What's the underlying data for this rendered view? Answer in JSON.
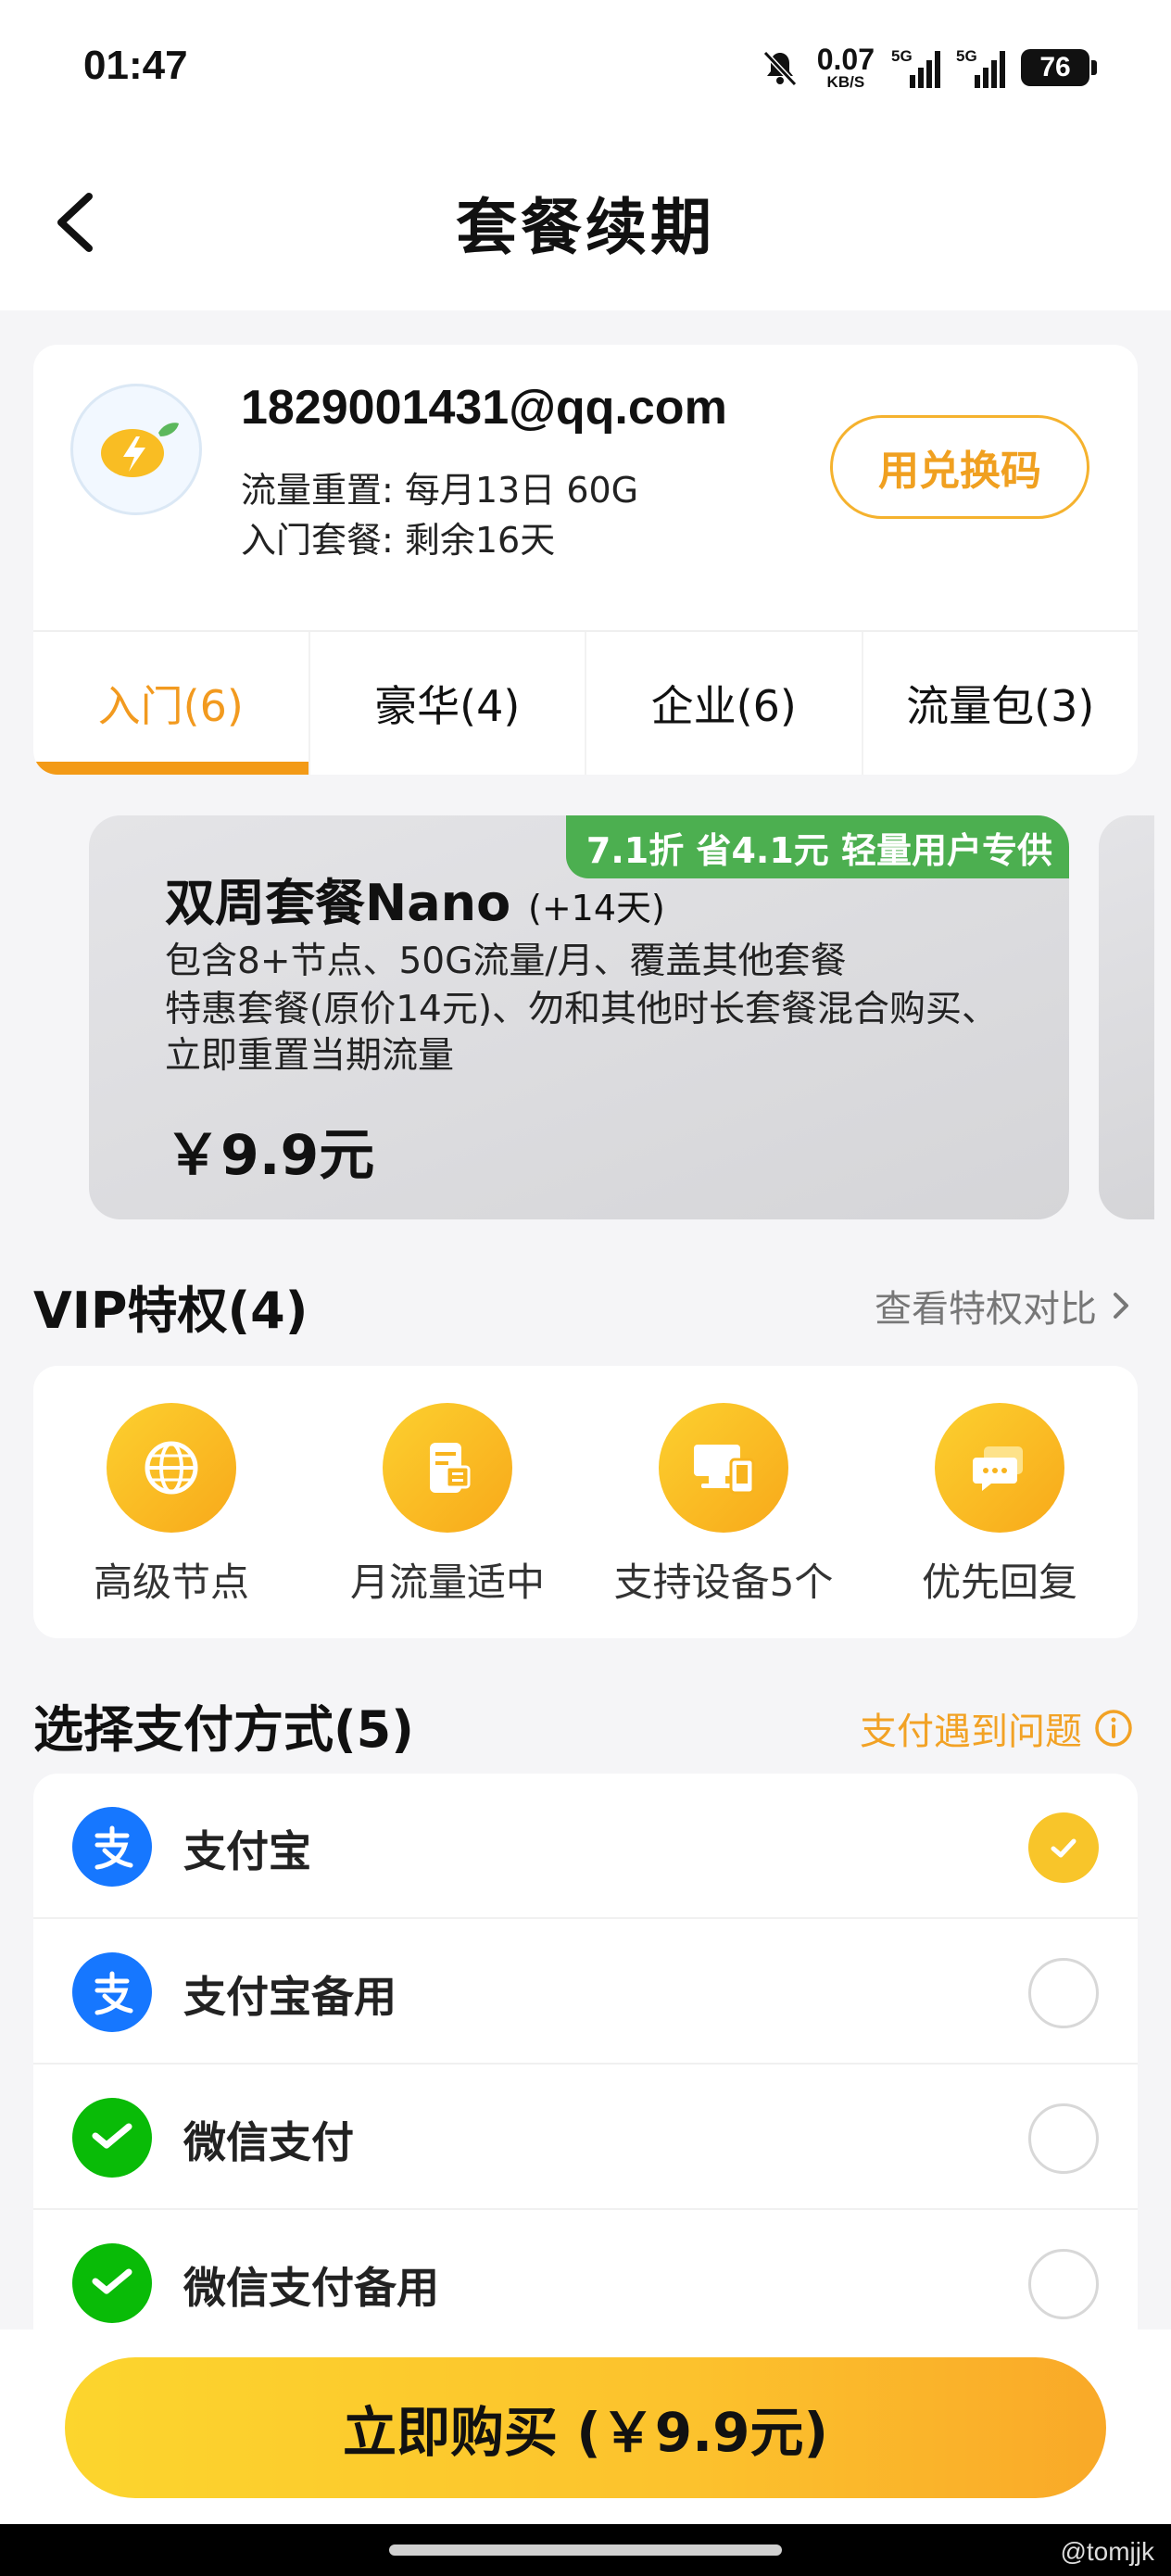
{
  "status_bar": {
    "time": "01:47",
    "net_speed": "0.07",
    "net_unit": "KB/S",
    "sim1": "5G",
    "sim2": "5G",
    "battery": "76"
  },
  "header": {
    "title": "套餐续期"
  },
  "account": {
    "email": "1829001431@qq.com",
    "reset_info": "流量重置: 每月13日 60G",
    "plan_info": "入门套餐: 剩余16天",
    "redeem_label": "用兑换码"
  },
  "tabs": [
    {
      "label": "入门(6)",
      "active": true
    },
    {
      "label": "豪华(4)",
      "active": false
    },
    {
      "label": "企业(6)",
      "active": false
    },
    {
      "label": "流量包(3)",
      "active": false
    }
  ],
  "plan": {
    "badge": "7.1折 省4.1元 轻量用户专供",
    "name": "双周套餐Nano",
    "name_suffix": "(+14天)",
    "desc_lines": [
      "包含8+节点、50G流量/月、覆盖其他套餐",
      "特惠套餐(原价14元)、勿和其他时长套餐混合购买、",
      "立即重置当期流量"
    ],
    "price": "￥9.9元"
  },
  "vip": {
    "title": "VIP特权(4)",
    "compare_link": "查看特权对比",
    "items": [
      {
        "label": "高级节点",
        "icon": "globe-icon"
      },
      {
        "label": "月流量适中",
        "icon": "data-usage-icon"
      },
      {
        "label": "支持设备5个",
        "icon": "devices-icon"
      },
      {
        "label": "优先回复",
        "icon": "chat-icon"
      }
    ]
  },
  "payment": {
    "title": "选择支付方式(5)",
    "help_link": "支付遇到问题",
    "methods": [
      {
        "label": "支付宝",
        "icon": "alipay-icon",
        "selected": true
      },
      {
        "label": "支付宝备用",
        "icon": "alipay-icon",
        "selected": false
      },
      {
        "label": "微信支付",
        "icon": "wechat-pay-icon",
        "selected": false
      },
      {
        "label": "微信支付备用",
        "icon": "wechat-pay-icon",
        "selected": false
      }
    ]
  },
  "buy_button": {
    "label": "立即购买 (￥9.9元)"
  },
  "watermark": "@tomjjk",
  "colors": {
    "accent": "#f39a16",
    "button_yellow": "#fcc22d",
    "badge_green": "#4caf50",
    "alipay_blue": "#1677ff",
    "wechat_green": "#09bb07"
  }
}
